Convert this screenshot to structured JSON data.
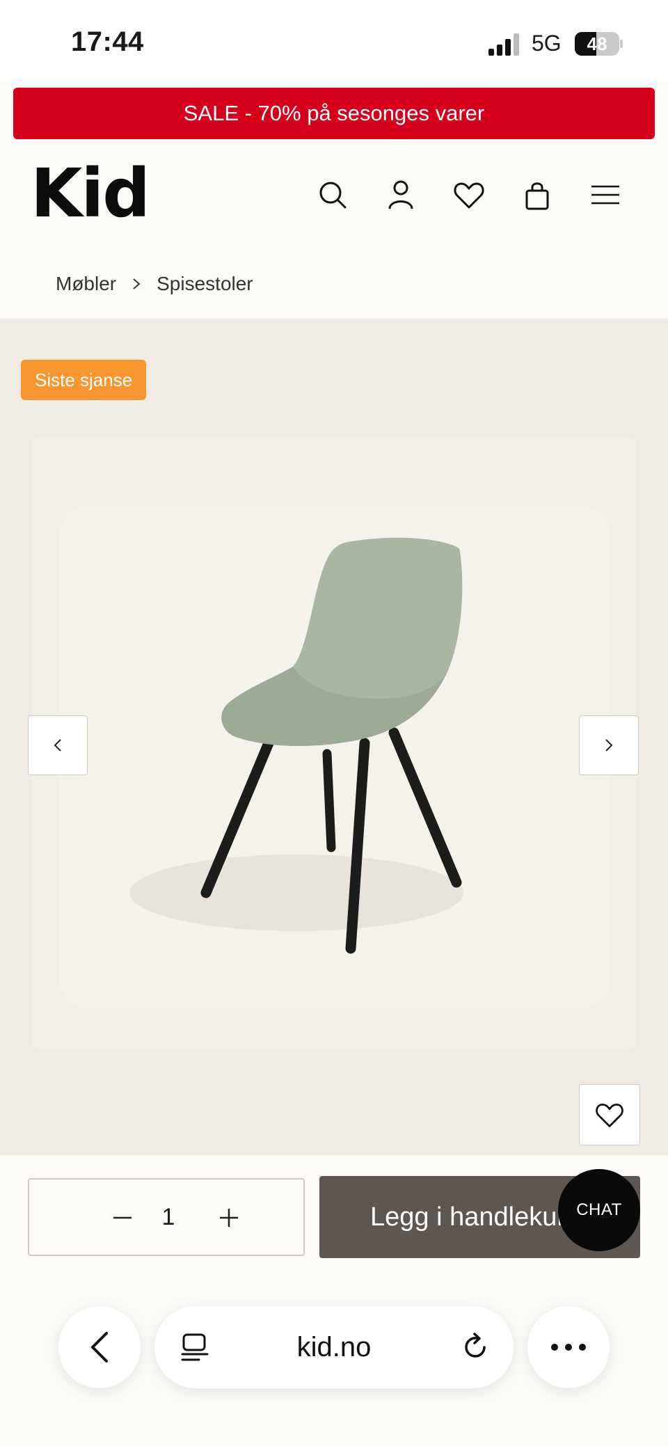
{
  "status_bar": {
    "time": "17:44",
    "network": "5G",
    "battery": "48"
  },
  "sale_banner": {
    "text": "SALE - 70% på sesonges varer"
  },
  "header": {
    "logo": "Kid"
  },
  "breadcrumb": {
    "items": [
      "Møbler",
      "Spisestoler"
    ]
  },
  "product": {
    "badge": "Siste sjanse"
  },
  "purchase": {
    "quantity": "1",
    "add_to_cart": "Legg i handlekurv",
    "chat": "CHAT"
  },
  "browser": {
    "url": "kid.no"
  },
  "colors": {
    "sale": "#d6001c",
    "badge": "#f7962f",
    "button": "#5e5751",
    "chair_seat": "#a9b7a1",
    "chair_legs": "#1c1c1a"
  }
}
